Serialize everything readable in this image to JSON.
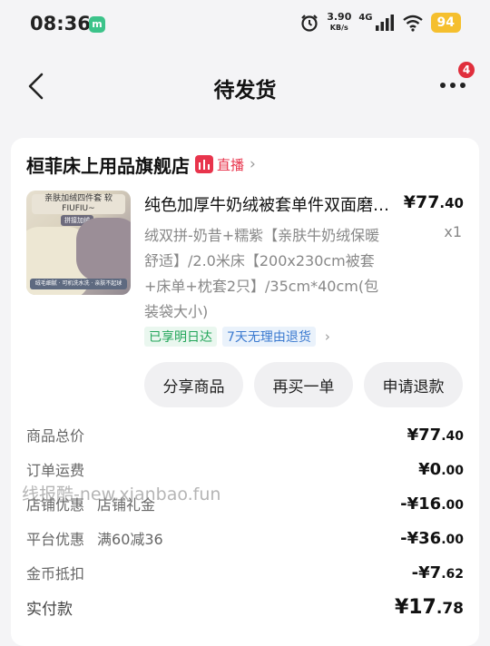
{
  "status_bar": {
    "time": "08:36",
    "app_icon": "m",
    "net_speed_value": "3.90",
    "net_speed_unit": "KB/s",
    "network": "4G",
    "battery": "94",
    "colors": {
      "battery": "#f5bf2e",
      "app_icon": "#3cc38a"
    }
  },
  "nav": {
    "title": "待发货",
    "more_badge": "4"
  },
  "store": {
    "name": "桓菲床上用品旗舰店",
    "live_label": "直播"
  },
  "product": {
    "image_text_top": "亲肤加绒四件套 软FIUFIU~",
    "image_tag": "拼接加绒",
    "image_text_bottom": "绒毛细腻 · 可机洗水洗 · 亲肤不起球",
    "title": "纯色加厚牛奶绒被套单件双面磨毛珊瑚绒",
    "price_int": "¥77",
    "price_dec": ".40",
    "spec": "绒双拼-奶昔+糯紫【亲肤牛奶绒保暖舒适】/2.0米床【200x230cm被套+床单+枕套2只】/35cm*40cm(包装袋大小)",
    "quantity": "x1",
    "tags": [
      "已享明日达",
      "7天无理由退货"
    ]
  },
  "actions": [
    "分享商品",
    "再买一单",
    "申请退款"
  ],
  "summary": {
    "rows": [
      {
        "label": "商品总价",
        "sub": "",
        "value_int": "¥77",
        "value_dec": ".40"
      },
      {
        "label": "订单运费",
        "sub": "",
        "value_int": "¥0",
        "value_dec": ".00"
      },
      {
        "label": "店铺优惠",
        "sub": "店铺礼金",
        "value_int": "-¥16",
        "value_dec": ".00"
      },
      {
        "label": "平台优惠",
        "sub": "满60减36",
        "value_int": "-¥36",
        "value_dec": ".00"
      },
      {
        "label": "金币抵扣",
        "sub": "",
        "value_int": "-¥7",
        "value_dec": ".62"
      }
    ],
    "total": {
      "label": "实付款",
      "value_int": "¥17",
      "value_dec": ".78"
    }
  },
  "watermark": "线报酷-new.xianbao.fun"
}
